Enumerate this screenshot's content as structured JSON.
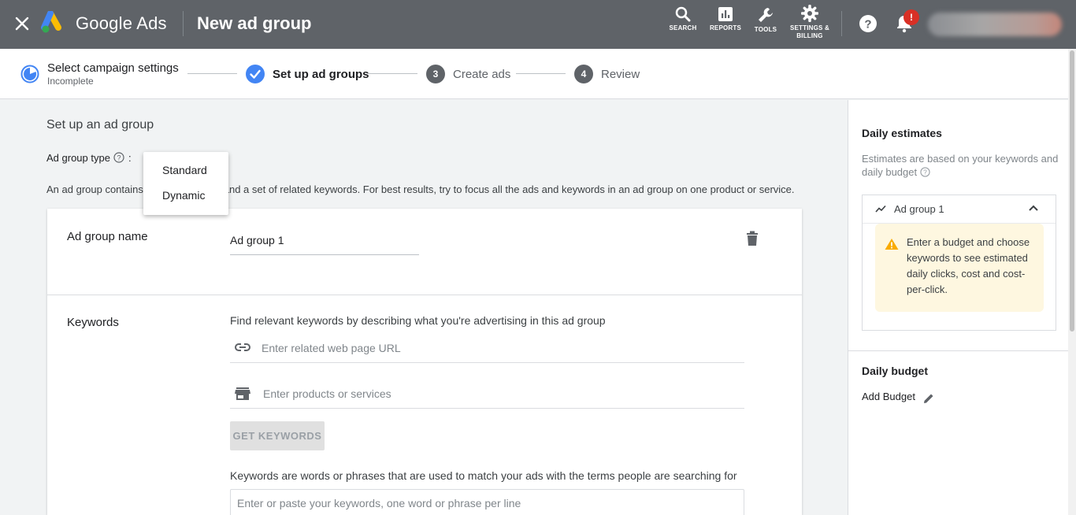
{
  "header": {
    "brand": "Google Ads",
    "page_title": "New ad group",
    "nav": [
      {
        "label": "SEARCH",
        "icon": "search-icon"
      },
      {
        "label": "REPORTS",
        "icon": "reports-icon"
      },
      {
        "label": "TOOLS",
        "icon": "wrench-icon"
      },
      {
        "label": "SETTINGS &",
        "label2": "BILLING",
        "icon": "gear-icon"
      }
    ],
    "notification_count": "!"
  },
  "stepper": {
    "steps": [
      {
        "title": "Select campaign settings",
        "subtitle": "Incomplete",
        "state": "incomplete"
      },
      {
        "title": "Set up ad groups",
        "state": "current"
      },
      {
        "number": "3",
        "title": "Create ads",
        "state": "pending"
      },
      {
        "number": "4",
        "title": "Review",
        "state": "pending"
      }
    ]
  },
  "main": {
    "section_title": "Set up an ad group",
    "ad_group_type_label": "Ad group type",
    "colon": ":",
    "description": "An ad group contains one or more ads and a set of related keywords. For best results, try to focus all the ads and keywords in an ad group on one product or service.",
    "type_options": [
      "Standard",
      "Dynamic"
    ],
    "ad_group_name_label": "Ad group name",
    "ad_group_name_value": "Ad group 1",
    "keywords_label": "Keywords",
    "keywords_helper": "Find relevant keywords by describing what you're advertising in this ad group",
    "url_placeholder": "Enter related web page URL",
    "products_placeholder": "Enter products or services",
    "get_keywords_button": "GET KEYWORDS",
    "keywords_note": "Keywords are words or phrases that are used to match your ads with the terms people are searching for",
    "keywords_textarea_placeholder": "Enter or paste your keywords, one word or phrase per line"
  },
  "right_panel": {
    "title": "Daily estimates",
    "description": "Estimates are based on your keywords and daily budget",
    "estimate_group": "Ad group 1",
    "warning": "Enter a budget and choose keywords to see estimated daily clicks, cost and cost-per-click.",
    "budget_title": "Daily budget",
    "add_budget": "Add Budget"
  },
  "colors": {
    "topbar": "#5f6368",
    "accent": "#4285f4",
    "warning_bg": "#fef7e0",
    "warning_icon": "#f9ab00",
    "badge": "#d93025"
  }
}
